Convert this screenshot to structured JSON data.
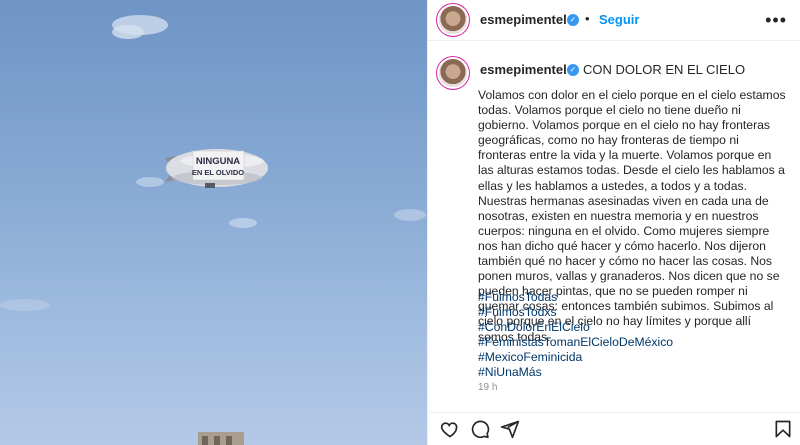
{
  "post": {
    "image": {
      "banner_text_1": "NINGUNA",
      "banner_text_2": "EN EL OLVIDO"
    },
    "header": {
      "username": "esmepimentel",
      "separator": "•",
      "follow_label": "Seguir",
      "more_icon": "more-horizontal-icon"
    },
    "caption": {
      "username": "esmepimentel",
      "title": "CON DOLOR EN EL CIELO",
      "body": "Volamos con dolor en el cielo porque en el cielo estamos todas. Volamos porque el cielo no tiene dueño ni gobierno. Volamos porque en el cielo no hay fronteras geográficas, como no hay fronteras de tiempo ni fronteras entre la vida y la muerte. Volamos porque en las alturas estamos todas. Desde el cielo les hablamos a ellas y les hablamos a ustedes, a todos y a todas. Nuestras hermanas asesinadas viven en cada una de nosotras, existen en nuestra memoria y en nuestros cuerpos: ninguna en el olvido. Como mujeres siempre nos han dicho qué hacer y cómo hacerlo. Nos dijeron también qué no hacer y cómo no hacer las cosas. Nos ponen muros, vallas y granaderos. Nos dicen que no se pueden hacer pintas, que no se pueden romper ni quemar cosas: entonces también subimos. Subimos al cielo porque en el cielo no hay límites y porque allí somos todas.",
      "hashtags": [
        "#FuimosTodas",
        "#FuimosTodxs",
        "#ConDolorEnElCielo",
        "#FeministasTomanElCieloDeMéxico",
        "#MexicoFeminicida",
        "#NiUnaMás"
      ],
      "time": "19 h"
    },
    "actions": {
      "like_icon": "heart-icon",
      "comment_icon": "comment-icon",
      "share_icon": "share-icon",
      "save_icon": "bookmark-icon"
    },
    "colors": {
      "link": "#00376b",
      "follow": "#0095f6",
      "verified": "#3897f0"
    }
  }
}
